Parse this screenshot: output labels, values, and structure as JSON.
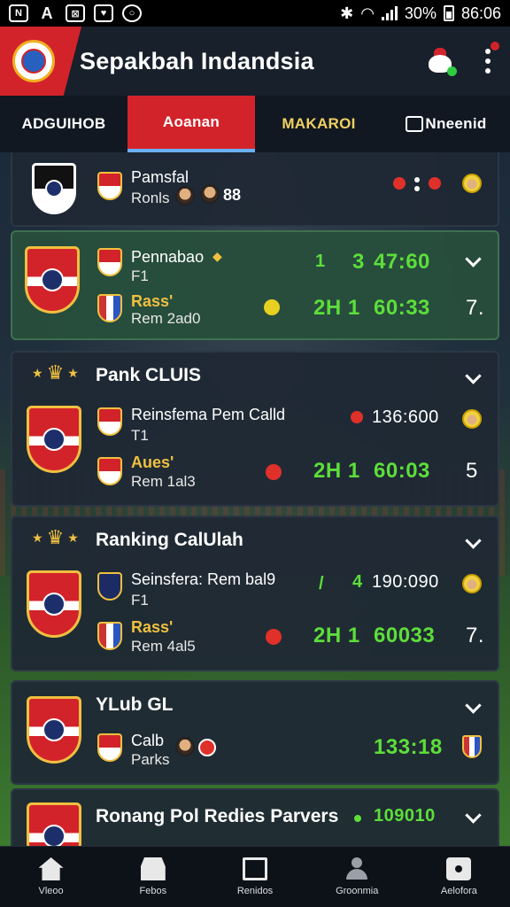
{
  "status_bar": {
    "battery": "30%",
    "time": "86:06"
  },
  "header": {
    "title": "Sepakbah Indandsia"
  },
  "tabs": [
    {
      "label": "ADGUIHOB"
    },
    {
      "label": "Aoanan"
    },
    {
      "label": "MAKAROI"
    },
    {
      "label": "Nneenid"
    }
  ],
  "cards": {
    "c1": {
      "line1": "Pamsfal",
      "line2": "Ronls",
      "tag": "88"
    },
    "c2": {
      "line1": "Pennabao",
      "line2": "F1",
      "line3": "Rass'",
      "line4": "Rem 2ad0",
      "n1": "1",
      "n2": "3",
      "n3": "47:60",
      "n4": "2H 1",
      "n5": "60:33",
      "n6": "7."
    },
    "c3": {
      "heading": "Pank CLUIS",
      "line1": "Reinsfema Pem Calld",
      "line2": "T1",
      "line3": "Aues'",
      "line4": "Rem 1al3",
      "n1": "136:600",
      "n2": "2H 1",
      "n3": "60:03",
      "n4": "5"
    },
    "c4": {
      "heading": "Ranking CalUlah",
      "line1": "Seinsfera: Rem bal9",
      "line2": "F1",
      "line3": "Rass'",
      "line4": "Rem 4al5",
      "n1": "/",
      "n2": "4",
      "n3": "190:090",
      "n4": "2H 1",
      "n5": "60033",
      "n6": "7."
    },
    "c5": {
      "heading": "YLub GL",
      "line1": "Calb",
      "line2": "Parks",
      "n1": "133:18"
    },
    "c6": {
      "heading": "Ronang Pol Redies Parvers",
      "n1": "109010"
    }
  },
  "bottom_nav": [
    {
      "label": "Vleoo"
    },
    {
      "label": "Febos"
    },
    {
      "label": "Renidos"
    },
    {
      "label": "Groonmia"
    },
    {
      "label": "Aelofora"
    }
  ],
  "colors": {
    "accent": "#d3232a",
    "score_green": "#5dde3a",
    "highlight_card": "#284e3c"
  }
}
